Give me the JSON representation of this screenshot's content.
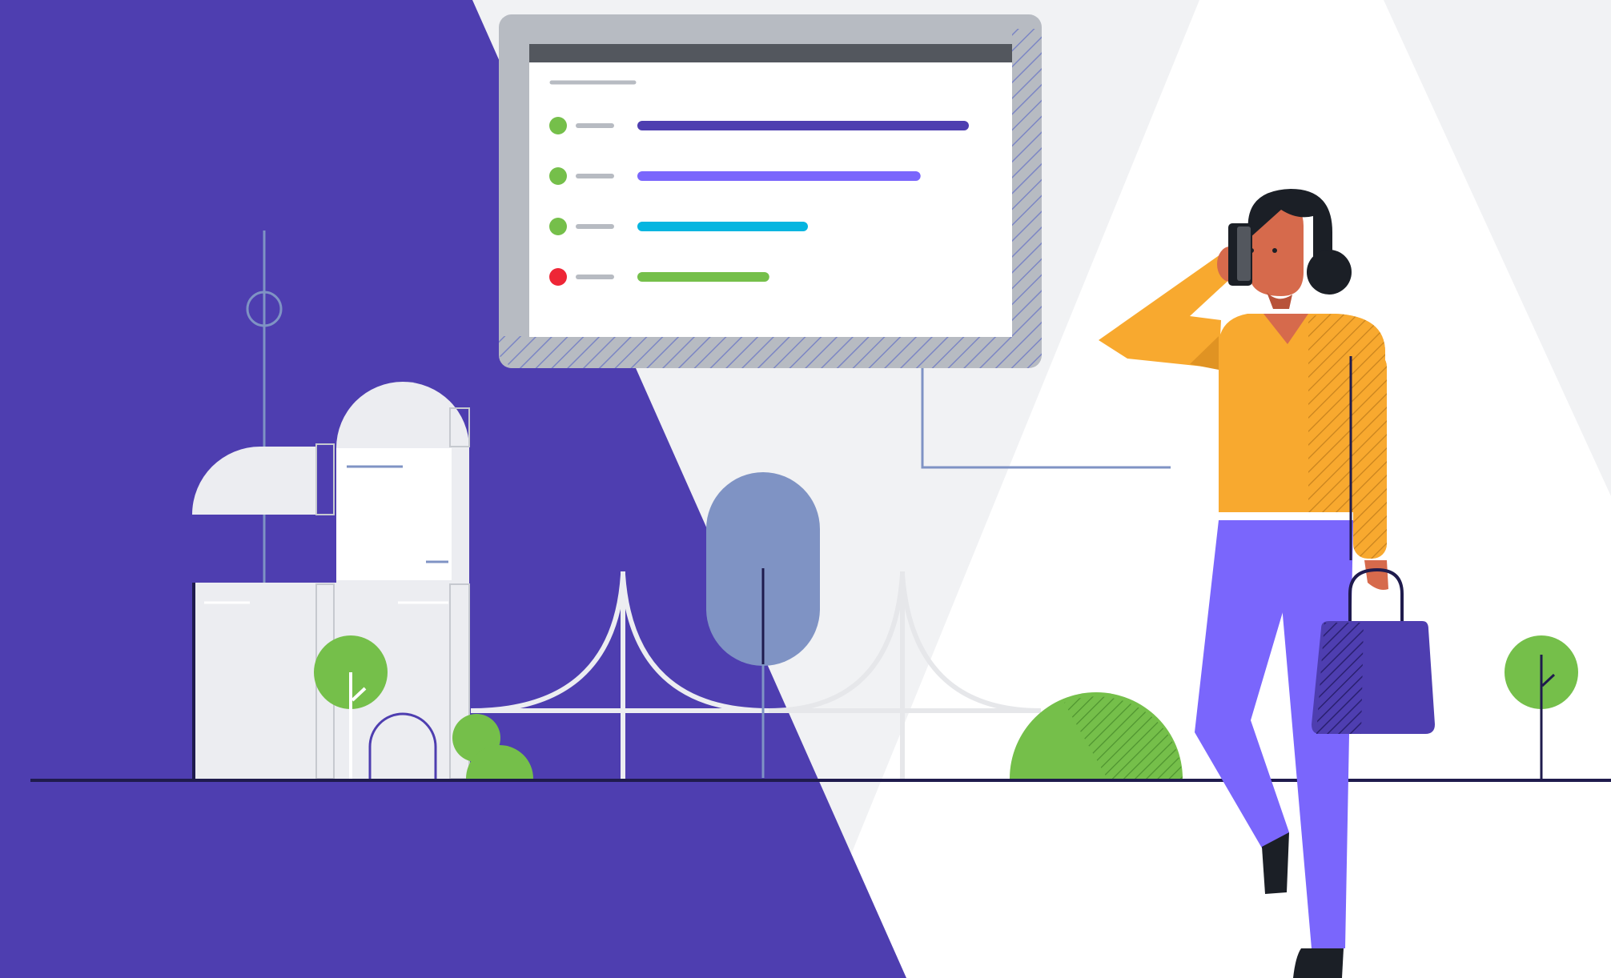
{
  "colors": {
    "background": "#f1f2f4",
    "purple_panel": "#4e3eb0",
    "white_beam": "#ffffff",
    "monitor_frame": "#b7bbc2",
    "monitor_titlebar": "#53575e",
    "accent_green": "#75bf4a",
    "accent_red": "#ee2636",
    "accent_cyan": "#05b5e0",
    "accent_violet": "#7a66fc",
    "accent_indigo": "#4e3eb0",
    "skin": "#d66a4c",
    "sweater": "#f8a92f",
    "pants": "#7a66fc",
    "hair": "#1b1f26",
    "ground_line": "#1f1b4d"
  },
  "screen": {
    "rows": [
      {
        "status": "ok",
        "status_color": "#75bf4a",
        "bar_color": "#4e3eb0",
        "bar_fraction": 1.0
      },
      {
        "status": "ok",
        "status_color": "#75bf4a",
        "bar_color": "#7a66fc",
        "bar_fraction": 0.85
      },
      {
        "status": "ok",
        "status_color": "#75bf4a",
        "bar_color": "#05b5e0",
        "bar_fraction": 0.5
      },
      {
        "status": "error",
        "status_color": "#ee2636",
        "bar_color": "#75bf4a",
        "bar_fraction": 0.38
      }
    ]
  },
  "icons": [
    "status-dot-icon",
    "tree-icon",
    "bush-icon",
    "phone-icon",
    "handbag-icon"
  ]
}
